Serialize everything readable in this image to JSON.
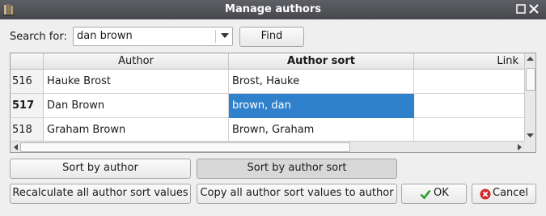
{
  "window": {
    "title": "Manage authors"
  },
  "search": {
    "label": "Search for:",
    "value": "dan brown",
    "find_label": "Find"
  },
  "table": {
    "headers": [
      "Author",
      "Author sort",
      "Link"
    ],
    "rows": [
      {
        "id": "516",
        "author": "Hauke Brost",
        "sort": "Brost, Hauke",
        "link": ""
      },
      {
        "id": "517",
        "author": "Dan Brown",
        "sort": "brown, dan",
        "link": ""
      },
      {
        "id": "518",
        "author": "Graham Brown",
        "sort": "Brown, Graham",
        "link": ""
      }
    ]
  },
  "buttons": {
    "sort_by_author": "Sort by author",
    "sort_by_author_sort": "Sort by author sort",
    "recalculate": "Recalculate all author sort values",
    "copy": "Copy all author sort values to author",
    "ok": "OK",
    "cancel": "Cancel"
  },
  "colors": {
    "selection": "#3081cc",
    "ok_icon": "#2e9a2e",
    "cancel_icon": "#d42a2a"
  }
}
